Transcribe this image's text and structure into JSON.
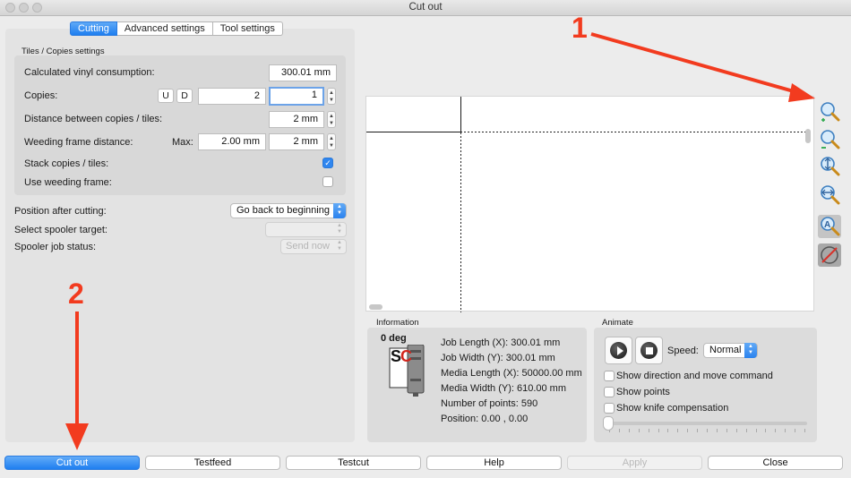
{
  "window": {
    "title": "Cut out"
  },
  "tabs": [
    {
      "label": "Cutting",
      "active": true
    },
    {
      "label": "Advanced settings",
      "active": false
    },
    {
      "label": "Tool settings",
      "active": false
    }
  ],
  "tiles": {
    "title": "Tiles / Copies settings",
    "vinyl_label": "Calculated vinyl consumption:",
    "vinyl_value": "300.01 mm",
    "copies_label": "Copies:",
    "copies_u": "U",
    "copies_d": "D",
    "copies_value1": "2",
    "copies_value2": "1",
    "distance_label": "Distance between copies / tiles:",
    "distance_value": "2 mm",
    "weeding_label": "Weeding frame distance:",
    "weeding_max_label": "Max:",
    "weeding_max_value": "2.00 mm",
    "weeding_value": "2 mm",
    "stack_label": "Stack copies / tiles:",
    "stack_checked": true,
    "use_weeding_label": "Use weeding frame:",
    "use_weeding_checked": false
  },
  "after_cut": {
    "position_label": "Position after cutting:",
    "position_value": "Go back to beginning",
    "spooler_target_label": "Select spooler target:",
    "spooler_target_value": "",
    "spooler_status_label": "Spooler job status:",
    "spooler_status_value": "Send now"
  },
  "tools": [
    {
      "icon": "zoom-in-icon"
    },
    {
      "icon": "zoom-out-icon"
    },
    {
      "icon": "zoom-fit-height-icon"
    },
    {
      "icon": "zoom-fit-width-icon"
    },
    {
      "icon": "zoom-text-icon"
    },
    {
      "icon": "no-preview-icon"
    }
  ],
  "information": {
    "title": "Information",
    "angle": "0 deg",
    "logo_text": "SC",
    "lines": [
      "Job Length (X): 300.01 mm",
      "Job Width (Y): 300.01 mm",
      "Media Length (X): 50000.00 mm",
      "Media Width (Y): 610.00 mm",
      "Number of points: 590",
      "Position: 0.00 , 0.00"
    ]
  },
  "animate": {
    "title": "Animate",
    "speed_label": "Speed:",
    "speed_value": "Normal",
    "options": [
      {
        "label": "Show direction and move command",
        "checked": false
      },
      {
        "label": "Show points",
        "checked": false
      },
      {
        "label": "Show knife compensation",
        "checked": false
      }
    ],
    "slider_value": 0
  },
  "buttons": {
    "cut_out": "Cut out",
    "testfeed": "Testfeed",
    "testcut": "Testcut",
    "help": "Help",
    "apply": "Apply",
    "close": "Close"
  },
  "annotations": {
    "marker1": "1",
    "marker2": "2"
  },
  "colors": {
    "accent": "#1f7ef0",
    "marker": "#f23b1f"
  }
}
